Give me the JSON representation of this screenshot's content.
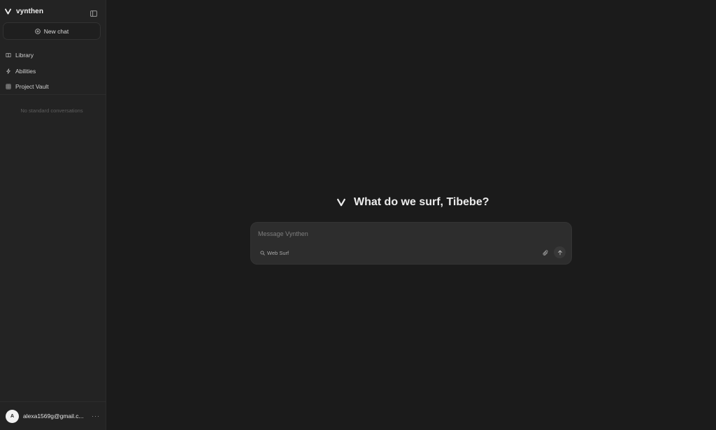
{
  "brand": {
    "name": "vynthen",
    "logo_icon": "v-logo-icon"
  },
  "sidebar": {
    "collapse_icon": "sidebar-toggle-icon",
    "new_chat_label": "New chat",
    "items": [
      {
        "label": "Library",
        "icon": "book-icon"
      },
      {
        "label": "Abilities",
        "icon": "bolt-icon"
      },
      {
        "label": "Project Vault",
        "icon": "grid-icon"
      }
    ],
    "empty_state": "No standard conversations"
  },
  "user": {
    "avatar_initial": "A",
    "email": "alexa1569g@gmail.c...",
    "more_label": "···"
  },
  "main": {
    "greeting": "What do we surf, Tibebe?",
    "composer": {
      "placeholder": "Message Vynthen",
      "web_surf_label": "Web Surf"
    }
  },
  "colors": {
    "background": "#1b1b1b",
    "sidebar": "#232323",
    "composer": "#2d2d2d",
    "text": "#e8e8e8"
  }
}
